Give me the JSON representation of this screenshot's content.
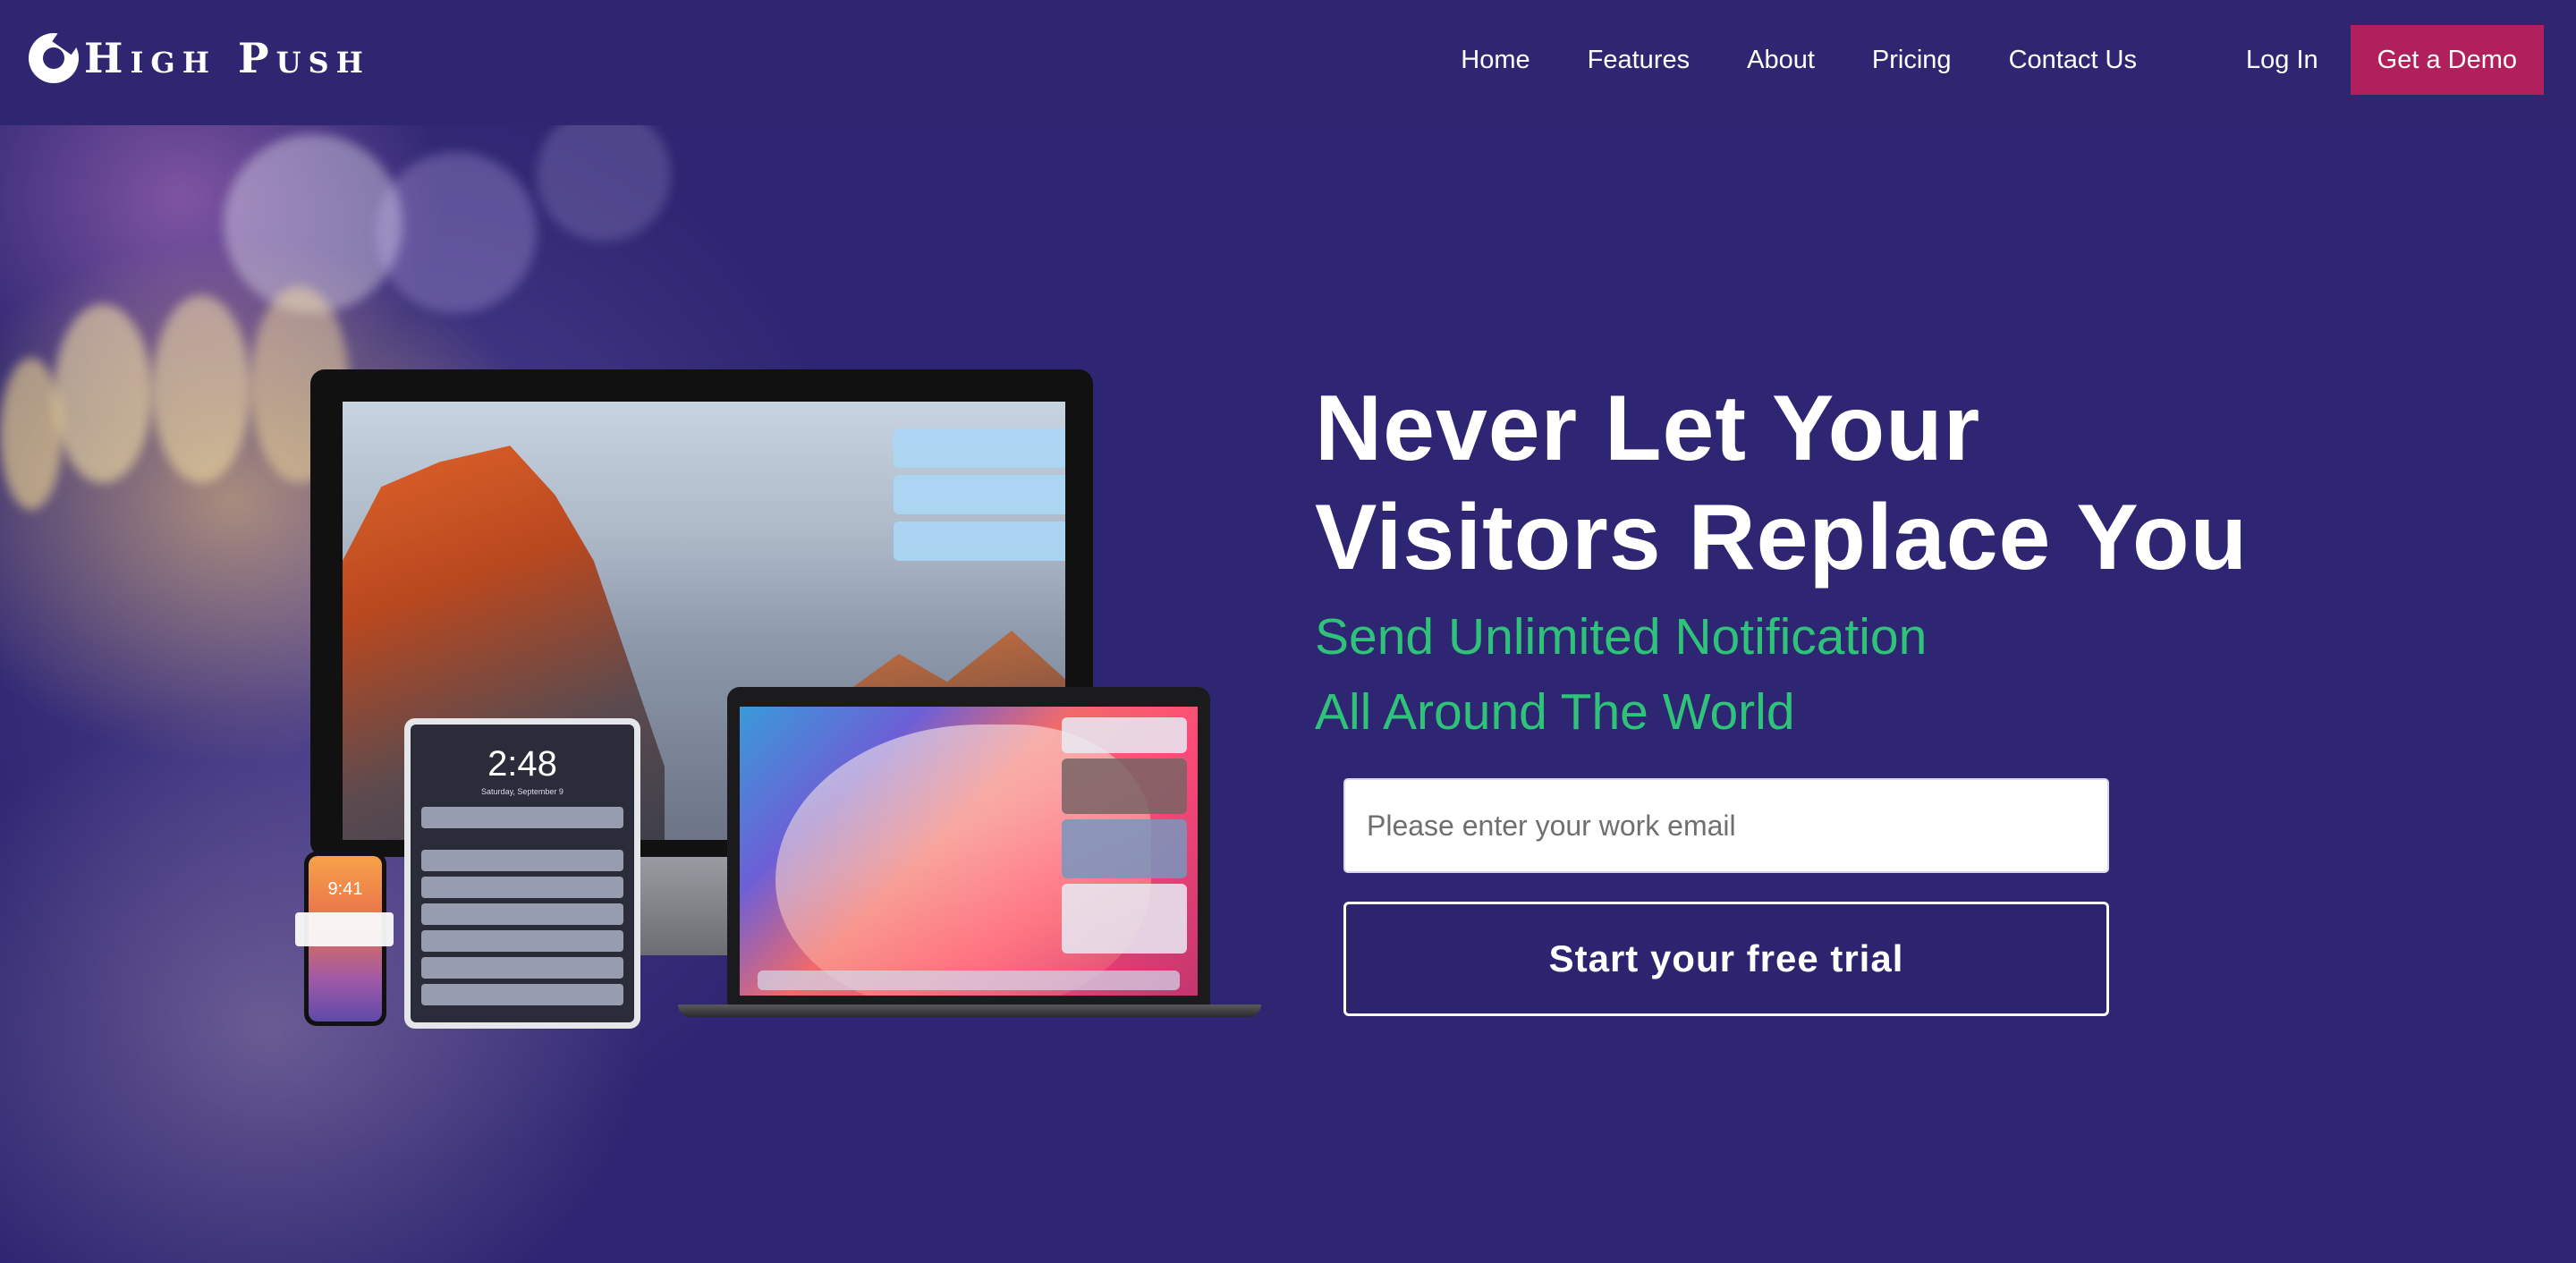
{
  "header": {
    "logo_text": "High Push",
    "nav": {
      "home": "Home",
      "features": "Features",
      "about": "About",
      "pricing": "Pricing",
      "contact": "Contact Us",
      "login": "Log In",
      "demo": "Get a Demo"
    }
  },
  "devices": {
    "tablet_time": "2:48",
    "tablet_date": "Saturday, September 9",
    "phone_time": "9:41"
  },
  "hero": {
    "title_line1": "Never Let Your",
    "title_line2": "Visitors Replace You",
    "subtitle_line1": "Send Unlimited Notification",
    "subtitle_line2": "All Around The World",
    "email_placeholder": "Please enter your work email",
    "cta_label": "Start your free trial"
  },
  "colors": {
    "background": "#2e2672",
    "accent_button": "#b0205c",
    "subtitle_green": "#2fc37a"
  }
}
